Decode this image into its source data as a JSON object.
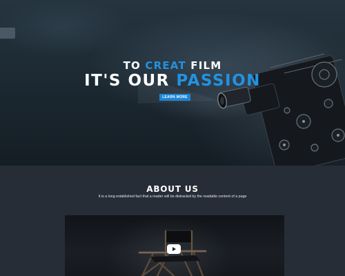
{
  "hero": {
    "subtitle_lead": "TO ",
    "subtitle_accent": "CREAT",
    "subtitle_tail": " FILM",
    "title_lead": "IT'S OUR ",
    "title_accent": "PASSION",
    "cta_label": "LEARN MORE"
  },
  "about": {
    "title": "ABOUT US",
    "text": "It is a long established fact that a reader will be distracted by the readable content of a page"
  },
  "video": {
    "play_icon": "play-icon"
  },
  "colors": {
    "accent": "#2392e0",
    "button": "#1e86d4",
    "section_bg": "#262d36"
  }
}
